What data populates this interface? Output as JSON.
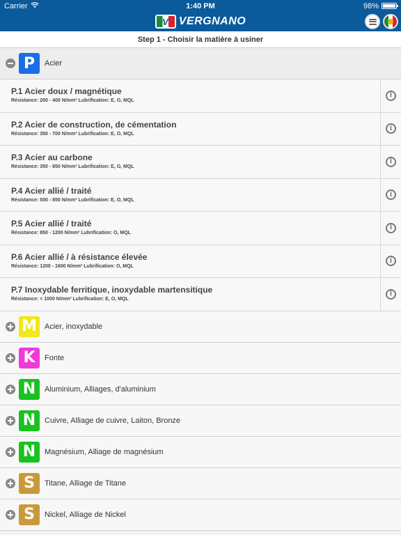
{
  "status_bar": {
    "carrier": "Carrier",
    "time": "1:40 PM",
    "battery": "98%"
  },
  "header": {
    "brand": "VERGNANO",
    "logo_mark": "V"
  },
  "step": {
    "title": "Step 1 - Choisir la matière à usiner"
  },
  "expanded_group": {
    "letter": "P",
    "color": "#1a6fe8",
    "label": "Acier",
    "items": [
      {
        "title": "P.1 Acier doux / magnétique",
        "sub": "Résistance: 200 - 400 N/mm²  Lubrification: E, O, MQL"
      },
      {
        "title": "P.2 Acier de construction, de cémentation",
        "sub": "Résistance: 350 - 700 N/mm²  Lubrification: E, O, MQL"
      },
      {
        "title": "P.3 Acier au carbone",
        "sub": "Résistance: 350 - 850 N/mm²  Lubrification: E, O, MQL"
      },
      {
        "title": "P.4 Acier allié / traité",
        "sub": "Résistance: 500 - 850 N/mm²  Lubrification: E, O, MQL"
      },
      {
        "title": "P.5 Acier allié / traité",
        "sub": "Résistance: 850 - 1200 N/mm²  Lubrification: O, MQL"
      },
      {
        "title": "P.6 Acier allié / à résistance élevée",
        "sub": "Résistance: 1200 - 1600 N/mm²  Lubrification: O, MQL"
      },
      {
        "title": "P.7 Inoxydable ferritique, inoxydable martensitique",
        "sub": "Résistance: < 1000 N/mm²  Lubrification: E, O, MQL"
      }
    ]
  },
  "collapsed_groups": [
    {
      "letter": "M",
      "color": "#f0e81a",
      "label": "Acier, inoxydable"
    },
    {
      "letter": "K",
      "color": "#f03ad8",
      "label": "Fonte"
    },
    {
      "letter": "N",
      "color": "#19c21f",
      "label": "Aluminium, Alliages, d'aluminium"
    },
    {
      "letter": "N",
      "color": "#19c21f",
      "label": "Cuivre, Alliage de cuivre, Laiton, Bronze"
    },
    {
      "letter": "N",
      "color": "#19c21f",
      "label": "Magnésium, Alliage de magnésium"
    },
    {
      "letter": "S",
      "color": "#c99a3a",
      "label": "Titane, Alliage de Titane"
    },
    {
      "letter": "S",
      "color": "#c99a3a",
      "label": "Nickel, Alliage de Nickel"
    }
  ]
}
